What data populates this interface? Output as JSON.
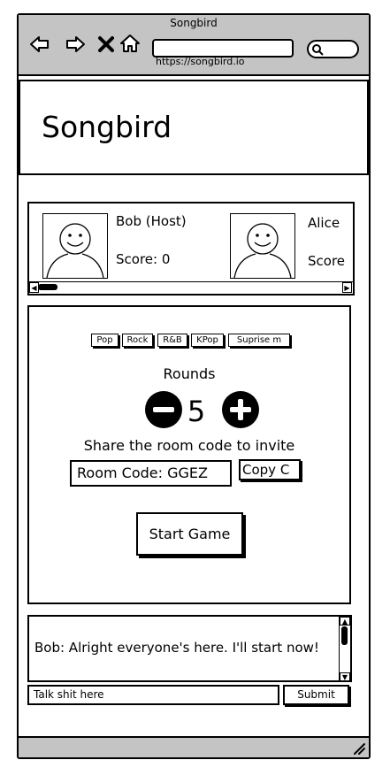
{
  "window": {
    "title": "Songbird",
    "url": "https://songbird.io"
  },
  "nav": {
    "back_icon": "arrow-left-icon",
    "forward_icon": "arrow-right-icon",
    "stop_icon": "close-icon",
    "home_icon": "home-icon",
    "search_icon": "search-icon"
  },
  "header": {
    "title": "Songbird"
  },
  "players": [
    {
      "name": "Bob (Host)",
      "score_label": "Score: 0"
    },
    {
      "name": "Alice",
      "score_label": "Score"
    }
  ],
  "genres": [
    "Pop",
    "Rock",
    "R&B",
    "KPop",
    "Suprise m"
  ],
  "rounds": {
    "label": "Rounds",
    "value": "5"
  },
  "invite": {
    "text": "Share the room code to invite",
    "room_code": "Room Code: GGEZ",
    "copy_label": "Copy C"
  },
  "start_label": "Start Game",
  "chat": {
    "messages": [
      "Bob: Alright everyone's here. I'll start now!"
    ],
    "input_placeholder": "Talk shit here",
    "submit_label": "Submit"
  },
  "colors": {
    "chrome": "#c4c4c4",
    "ink": "#000000"
  }
}
